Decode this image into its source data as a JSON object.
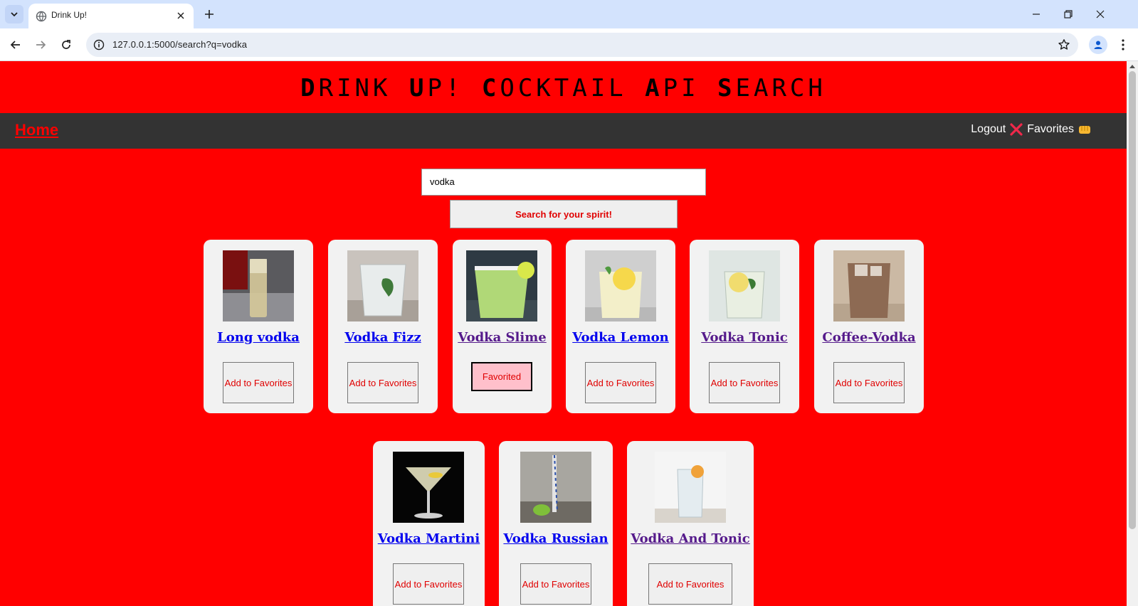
{
  "browser": {
    "tab_title": "Drink Up!",
    "url": "127.0.0.1:5000/search?q=vodka"
  },
  "site": {
    "title_parts": [
      {
        "cap": "D",
        "rest": "RINK "
      },
      {
        "cap": "U",
        "rest": "P! "
      },
      {
        "cap": "C",
        "rest": "OCKTAIL "
      },
      {
        "cap": "A",
        "rest": "PI "
      },
      {
        "cap": "S",
        "rest": "EARCH"
      }
    ],
    "colors": {
      "page_bg": "#ff0000",
      "nav_bg": "#333333",
      "card_bg": "#f2f2f2",
      "accent": "#e00000",
      "favorited_bg": "#ffc0cb"
    }
  },
  "nav": {
    "home": "Home",
    "logout": "Logout",
    "favorites": "Favorites"
  },
  "search": {
    "value": "vodka",
    "button": "Search for your spirit!"
  },
  "drinks": [
    {
      "name": "Long vodka",
      "button": "Add to Favorites",
      "visited": false,
      "favorited": false
    },
    {
      "name": "Vodka Fizz",
      "button": "Add to Favorites",
      "visited": false,
      "favorited": false
    },
    {
      "name": "Vodka Slime",
      "button": "Favorited",
      "visited": true,
      "favorited": true
    },
    {
      "name": "Vodka Lemon",
      "button": "Add to Favorites",
      "visited": false,
      "favorited": false
    },
    {
      "name": "Vodka Tonic",
      "button": "Add to Favorites",
      "visited": true,
      "favorited": false
    },
    {
      "name": "Coffee-Vodka",
      "button": "Add to Favorites",
      "visited": true,
      "favorited": false
    },
    {
      "name": "Vodka Martini",
      "button": "Add to Favorites",
      "visited": false,
      "favorited": false
    },
    {
      "name": "Vodka Russian",
      "button": "Add to Favorites",
      "visited": false,
      "favorited": false
    },
    {
      "name": "Vodka And Tonic",
      "button": "Add to Favorites",
      "visited": true,
      "favorited": false
    }
  ]
}
